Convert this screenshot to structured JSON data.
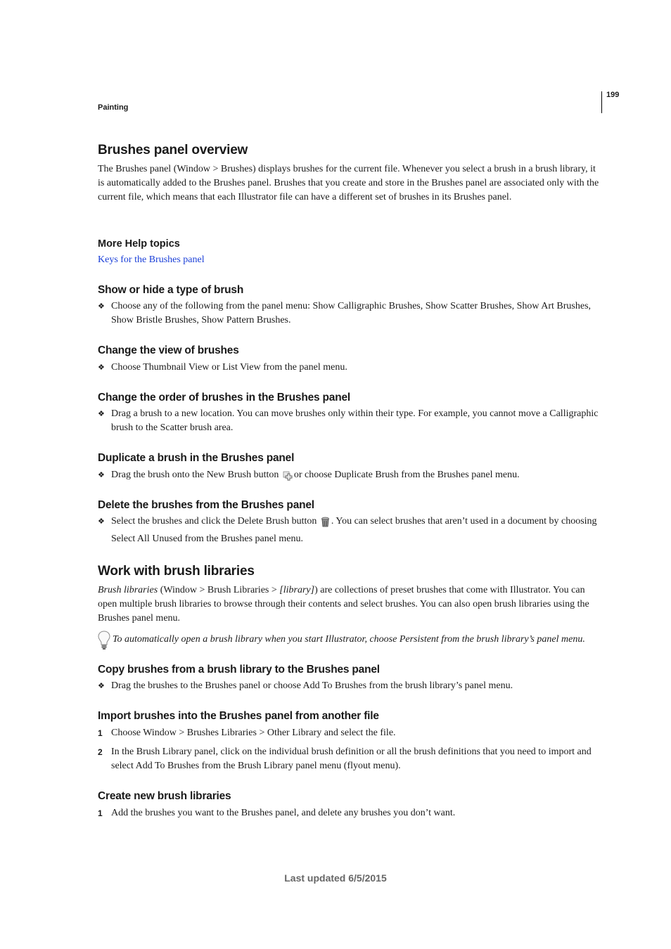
{
  "header": {
    "running_title": "Painting",
    "page_number": "199"
  },
  "sections": {
    "overview": {
      "title": "Brushes panel overview",
      "body": "The Brushes panel (Window > Brushes) displays brushes for the current file. Whenever you select a brush in a brush library, it is automatically added to the Brushes panel. Brushes that you create and store in the Brushes panel are associated only with the current file, which means that each Illustrator file can have a different set of brushes in its Brushes panel.",
      "help_heading": "More Help topics",
      "help_link": "Keys for the Brushes panel"
    },
    "show_hide": {
      "title": "Show or hide a type of brush",
      "bullet": "Choose any of the following from the panel menu: Show Calligraphic Brushes, Show Scatter Brushes, Show Art Brushes, Show Bristle Brushes, Show Pattern Brushes."
    },
    "change_view": {
      "title": "Change the view of brushes",
      "bullet": "Choose Thumbnail View or List View from the panel menu."
    },
    "change_order": {
      "title": "Change the order of brushes in the Brushes panel",
      "bullet": "Drag a brush to a new location. You can move brushes only within their type. For example, you cannot move a Calligraphic brush to the Scatter brush area."
    },
    "duplicate": {
      "title": "Duplicate a brush in the Brushes panel",
      "bullet_before": "Drag the brush onto the New Brush button",
      "bullet_after": "or choose Duplicate Brush from the Brushes panel menu."
    },
    "delete": {
      "title": "Delete the brushes from the Brushes panel",
      "bullet_before": "Select the brushes and click the Delete Brush button",
      "bullet_after": ". You can select brushes that aren’t used in a document by choosing Select All Unused from the Brushes panel menu."
    },
    "libraries": {
      "title": "Work with brush libraries",
      "body_italic_term": "Brush libraries",
      "body_part1": " (Window > Brush Libraries > ",
      "body_italic_library": "[library]",
      "body_part2": ") are collections of preset brushes that come with Illustrator. You can open multiple brush libraries to browse through their contents and select brushes. You can also open brush libraries using the Brushes panel menu.",
      "tip": "To automatically open a brush library when you start Illustrator, choose Persistent from the brush library’s panel menu."
    },
    "copy": {
      "title": "Copy brushes from a brush library to the Brushes panel",
      "bullet": "Drag the brushes to the Brushes panel or choose Add To Brushes from the brush library’s panel menu."
    },
    "import": {
      "title": "Import brushes into the Brushes panel from another file",
      "steps": [
        {
          "num": "1",
          "text": "Choose Window > Brushes Libraries > Other Library and select the file."
        },
        {
          "num": "2",
          "text": "In the Brush Library panel, click on the individual brush definition or all the brush definitions that you need to import and select Add To Brushes from the Brush Library panel menu (flyout menu)."
        }
      ]
    },
    "create": {
      "title": "Create new brush libraries",
      "steps": [
        {
          "num": "1",
          "text": "Add the brushes you want to the Brushes panel, and delete any brushes you don’t want."
        }
      ]
    }
  },
  "bullet_glyph": "❖",
  "icons": {
    "new_brush": "new-brush-icon",
    "delete_brush": "trash-icon",
    "tip": "lightbulb-icon"
  },
  "colors": {
    "link": "#1a3fd8",
    "footer": "#666666"
  },
  "footer": {
    "text": "Last updated 6/5/2015"
  }
}
